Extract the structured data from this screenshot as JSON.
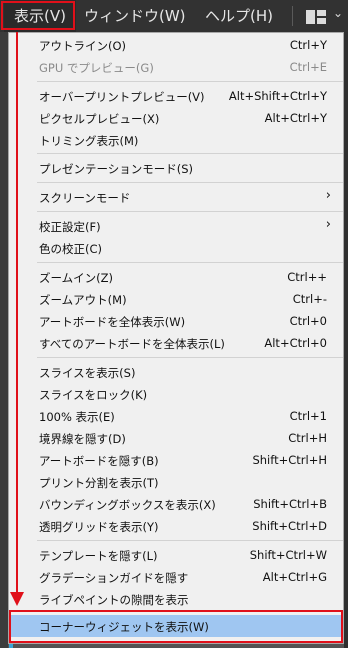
{
  "menubar": {
    "view": "表示(V)",
    "window": "ウィンドウ(W)",
    "help": "ヘルプ(H)",
    "chevron": "⌄"
  },
  "menu": {
    "outline": {
      "label": "アウトライン(O)",
      "shortcut": "Ctrl+Y"
    },
    "gpu_preview": {
      "label": "GPU でプレビュー(G)",
      "shortcut": "Ctrl+E"
    },
    "overprint_preview": {
      "label": "オーバープリントプレビュー(V)",
      "shortcut": "Alt+Shift+Ctrl+Y"
    },
    "pixel_preview": {
      "label": "ピクセルプレビュー(X)",
      "shortcut": "Alt+Ctrl+Y"
    },
    "trim_view": {
      "label": "トリミング表示(M)",
      "shortcut": ""
    },
    "presentation_mode": {
      "label": "プレゼンテーションモード(S)",
      "shortcut": ""
    },
    "screen_mode": {
      "label": "スクリーンモード",
      "shortcut": ""
    },
    "proof_setup": {
      "label": "校正設定(F)",
      "shortcut": ""
    },
    "proof_colors": {
      "label": "色の校正(C)",
      "shortcut": ""
    },
    "zoom_in": {
      "label": "ズームイン(Z)",
      "shortcut": "Ctrl++"
    },
    "zoom_out": {
      "label": "ズームアウト(M)",
      "shortcut": "Ctrl+-"
    },
    "fit_artboard": {
      "label": "アートボードを全体表示(W)",
      "shortcut": "Ctrl+0"
    },
    "fit_all_artboards": {
      "label": "すべてのアートボードを全体表示(L)",
      "shortcut": "Alt+Ctrl+0"
    },
    "show_slices": {
      "label": "スライスを表示(S)",
      "shortcut": ""
    },
    "lock_slices": {
      "label": "スライスをロック(K)",
      "shortcut": ""
    },
    "actual_size": {
      "label": "100% 表示(E)",
      "shortcut": "Ctrl+1"
    },
    "hide_edges": {
      "label": "境界線を隠す(D)",
      "shortcut": "Ctrl+H"
    },
    "hide_artboards": {
      "label": "アートボードを隠す(B)",
      "shortcut": "Shift+Ctrl+H"
    },
    "show_print_tiling": {
      "label": "プリント分割を表示(T)",
      "shortcut": ""
    },
    "show_bounding_box": {
      "label": "バウンディングボックスを表示(X)",
      "shortcut": "Shift+Ctrl+B"
    },
    "show_transparency_grid": {
      "label": "透明グリッドを表示(Y)",
      "shortcut": "Shift+Ctrl+D"
    },
    "hide_template": {
      "label": "テンプレートを隠す(L)",
      "shortcut": "Shift+Ctrl+W"
    },
    "hide_gradient_annotator": {
      "label": "グラデーションガイドを隠す",
      "shortcut": "Alt+Ctrl+G"
    },
    "show_live_paint_gaps": {
      "label": "ライブペイントの隙間を表示",
      "shortcut": ""
    },
    "show_corner_widget": {
      "label": "コーナーウィジェットを表示(W)",
      "shortcut": ""
    },
    "submenu_arrow": "›"
  }
}
